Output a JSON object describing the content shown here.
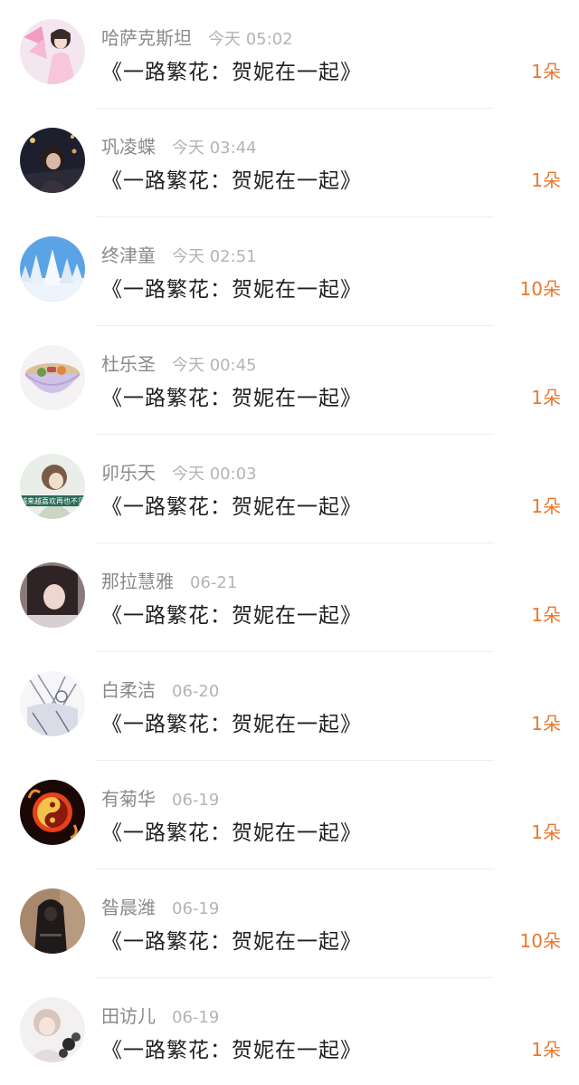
{
  "gifts": [
    {
      "name": "哈萨克斯坦",
      "time": "今天 05:02",
      "title": "《一路繁花：贺妮在一起》",
      "amount": "1朵",
      "avatar": "pink-girl-avatar"
    },
    {
      "name": "巩凌蝶",
      "time": "今天 03:44",
      "title": "《一路繁花：贺妮在一起》",
      "amount": "1朵",
      "avatar": "night-city-girl-avatar"
    },
    {
      "name": "终津童",
      "time": "今天 02:51",
      "title": "《一路繁花：贺妮在一起》",
      "amount": "10朵",
      "avatar": "snowy-forest-avatar"
    },
    {
      "name": "杜乐圣",
      "time": "今天 00:45",
      "title": "《一路繁花：贺妮在一起》",
      "amount": "1朵",
      "avatar": "noodle-bowl-avatar"
    },
    {
      "name": "卯乐天",
      "time": "今天 00:03",
      "title": "《一路繁花：贺妮在一起》",
      "amount": "1朵",
      "avatar": "girl-with-text-banner-avatar",
      "avatar_text": "越来越喜欢再也不见"
    },
    {
      "name": "那拉慧雅",
      "time": "06-21",
      "title": "《一路繁花：贺妮在一起》",
      "amount": "1朵",
      "avatar": "dark-hair-portrait-avatar"
    },
    {
      "name": "白柔洁",
      "time": "06-20",
      "title": "《一路繁花：贺妮在一起》",
      "amount": "1朵",
      "avatar": "anime-sketch-avatar"
    },
    {
      "name": "有菊华",
      "time": "06-19",
      "title": "《一路繁花：贺妮在一起》",
      "amount": "1朵",
      "avatar": "fire-yinyang-avatar"
    },
    {
      "name": "昝晨潍",
      "time": "06-19",
      "title": "《一路繁花：贺妮在一起》",
      "amount": "10朵",
      "avatar": "hooded-figure-avatar"
    },
    {
      "name": "田访儿",
      "time": "06-19",
      "title": "《一路繁花：贺妮在一起》",
      "amount": "1朵",
      "avatar": "girl-with-flowers-avatar"
    }
  ],
  "colors": {
    "name": "#8a8a8a",
    "time": "#b4b4b4",
    "title": "#1f1f1f",
    "amount": "#e8782c",
    "divider": "#efefef"
  }
}
